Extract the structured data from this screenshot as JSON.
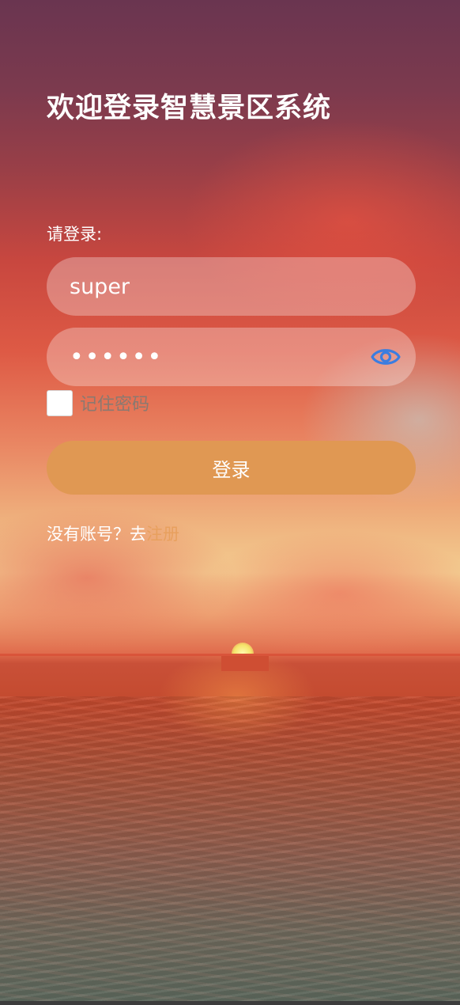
{
  "header": {
    "title": "欢迎登录智慧景区系统"
  },
  "form": {
    "prompt": "请登录:",
    "username_value": "super",
    "password_value": "••••••",
    "remember_label": "记住密码",
    "remember_checked": false,
    "login_label": "登录"
  },
  "footer": {
    "register_prefix": "没有账号？去",
    "register_link": "注册"
  },
  "icons": {
    "password_toggle": "eye-icon"
  },
  "colors": {
    "button": "#e09853",
    "link": "#e8a05e",
    "eye_icon": "#3b7de0"
  }
}
